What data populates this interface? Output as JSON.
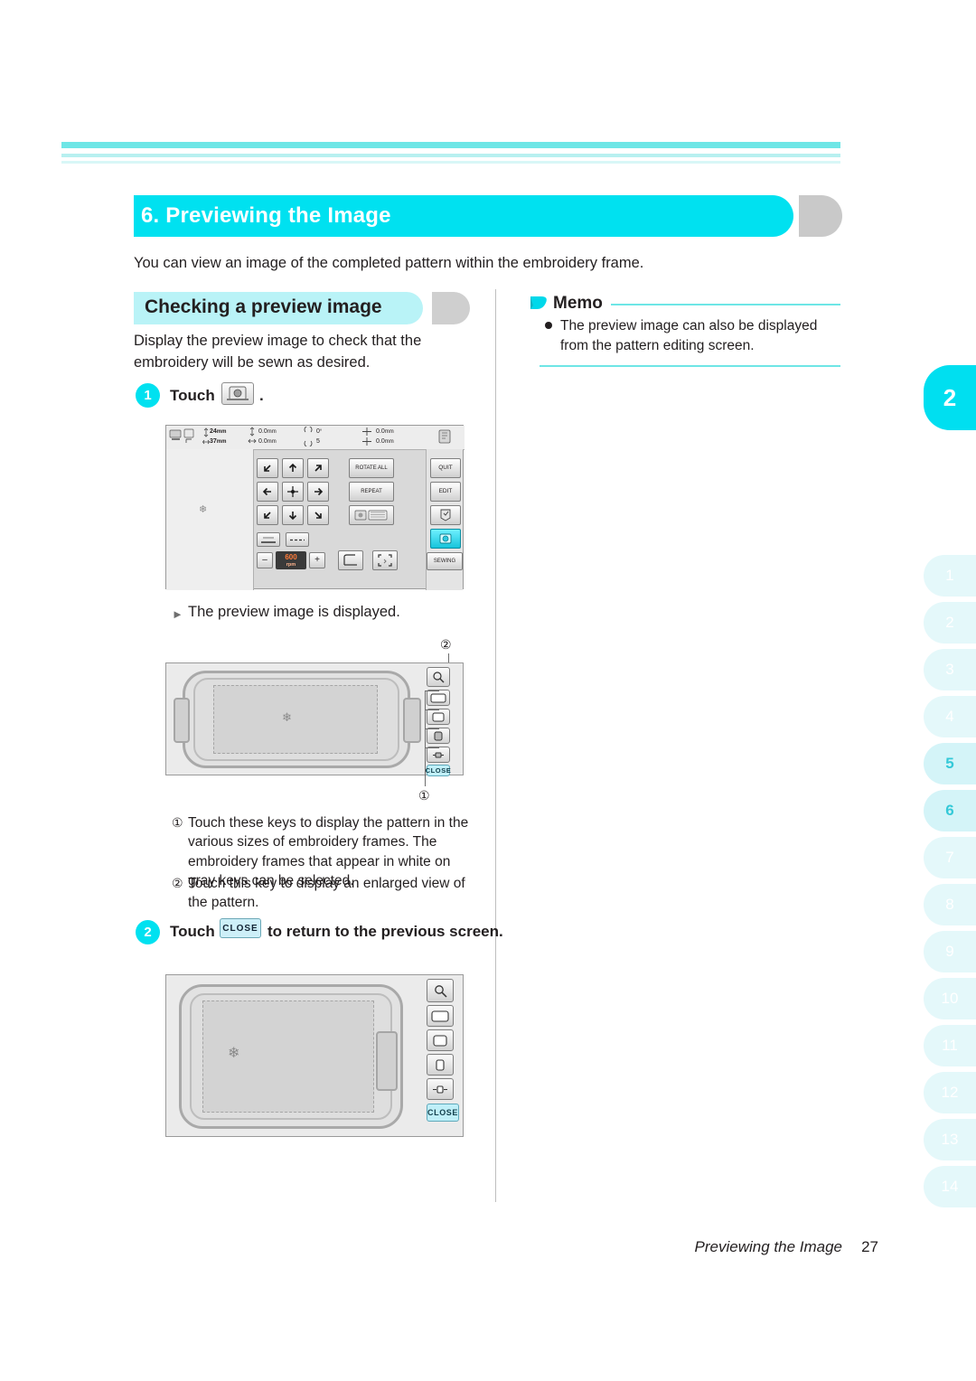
{
  "chapter": {
    "title": "6. Previewing the Image",
    "intro": "You can view an image of the completed pattern within the embroidery frame."
  },
  "section": {
    "title": "Checking a preview image",
    "lead": "Display the preview image to check that the embroidery will be sewn as desired."
  },
  "steps": {
    "one": {
      "number": "1",
      "label": "Touch",
      "period": ".",
      "result": "The preview image is displayed."
    },
    "two": {
      "number": "2",
      "label": "Touch",
      "key_label": "CLOSE",
      "tail": "to return to the previous screen."
    }
  },
  "callouts": {
    "one": "①",
    "two": "②",
    "note1_marker": "①",
    "note1_text": "Touch these keys to display the pattern in the various sizes of embroidery frames. The embroidery frames that appear in white on gray keys can be selected.",
    "note2_marker": "②",
    "note2_text": "Touch this key to display an enlarged view of the pattern."
  },
  "memo": {
    "title": "Memo",
    "text": "The preview image can also be displayed from the pattern editing screen."
  },
  "machine_screen": {
    "measure_1": "24",
    "measure_1_unit": "mm",
    "measure_2": "37",
    "measure_2_unit": "mm",
    "val_a": "0.0",
    "val_a_unit": "mm",
    "val_b": "0.0",
    "val_b_unit": "mm",
    "val_c": "0",
    "val_c_unit": "°",
    "val_d": "5",
    "val_e": "0.0",
    "val_e_unit": "mm",
    "val_f": "0.0",
    "val_f_unit": "mm",
    "buttons": {
      "rotate_all": "ROTATE ALL",
      "repeat": "REPEAT",
      "quit": "QUIT",
      "edit": "EDIT",
      "sewing": "SEWING",
      "minus": "–",
      "plus": "+",
      "rpm_value": "600",
      "rpm_label": "rpm"
    }
  },
  "preview_keys": {
    "close": "CLOSE"
  },
  "side_index": {
    "chapter_active": "2",
    "items": [
      "1",
      "2",
      "3",
      "4",
      "5",
      "6",
      "7",
      "8",
      "9",
      "10",
      "11",
      "12",
      "13",
      "14"
    ],
    "active_items": [
      "5",
      "6"
    ]
  },
  "footer": {
    "title": "Previewing the Image",
    "page": "27"
  },
  "colors": {
    "accent": "#00e1f0",
    "accent_light": "#b9f3f7",
    "rule": "#6ee6e6",
    "text": "#231f20"
  }
}
